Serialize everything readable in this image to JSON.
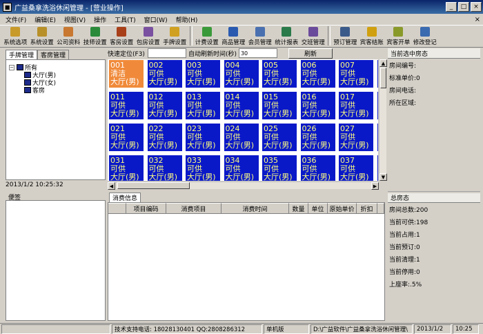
{
  "window": {
    "title": "广益桑拿洗浴休闲管理 - [营业操作]"
  },
  "menu": [
    "文件(F)",
    "编辑(E)",
    "视图(V)",
    "操作",
    "工具(T)",
    "窗口(W)",
    "帮助(H)"
  ],
  "toolbar": [
    {
      "label": "系统选项",
      "color": "#c89a2a",
      "icon": "system-options-icon"
    },
    {
      "label": "系统设置",
      "color": "#b8902a",
      "icon": "system-settings-icon"
    },
    {
      "label": "公司资料",
      "color": "#c87830",
      "icon": "company-info-icon"
    },
    {
      "label": "技师设置",
      "color": "#2a8a3a",
      "icon": "technician-icon"
    },
    {
      "label": "客房设置",
      "color": "#a8401a",
      "icon": "room-settings-icon"
    },
    {
      "label": "包房设置",
      "color": "#7a50a0",
      "icon": "private-room-icon"
    },
    {
      "label": "手牌设置",
      "color": "#d0a020",
      "icon": "hand-tag-icon"
    },
    {
      "label": "计费设置",
      "color": "#3a9a3a",
      "icon": "billing-icon"
    },
    {
      "label": "商品管理",
      "color": "#2a5ab0",
      "icon": "goods-icon"
    },
    {
      "label": "会员管理",
      "color": "#4a70b0",
      "icon": "member-icon"
    },
    {
      "label": "统计报表",
      "color": "#2a7a4a",
      "icon": "report-icon"
    },
    {
      "label": "交班管理",
      "color": "#6a4a9a",
      "icon": "shift-icon"
    },
    {
      "label": "预订管理",
      "color": "#3a5a8a",
      "icon": "booking-icon"
    },
    {
      "label": "宾客结账",
      "color": "#d0a010",
      "icon": "checkout-icon"
    },
    {
      "label": "宾客开单",
      "color": "#8a9a2a",
      "icon": "open-order-icon"
    },
    {
      "label": "修改登记",
      "color": "#3a6ab0",
      "icon": "edit-register-icon"
    }
  ],
  "left": {
    "tabs": [
      "手牌管理",
      "客房管理"
    ],
    "tree": {
      "root": "所有",
      "children": [
        "大厅(男)",
        "大厅(女)",
        "客房"
      ]
    },
    "datetime": "2013/1/2  10:25:32",
    "note_label": "便签"
  },
  "search": {
    "quick_locate": "快速定位(F3)",
    "refresh_interval_label": "自动刷新时间(秒)",
    "refresh_interval": "30",
    "refresh_button": "刷新"
  },
  "rooms": [
    {
      "no": "001",
      "status": "清洁",
      "area": "大厅(男)",
      "state": "clean"
    },
    {
      "no": "002",
      "status": "可供",
      "area": "大厅(男)"
    },
    {
      "no": "003",
      "status": "可供",
      "area": "大厅(男)"
    },
    {
      "no": "004",
      "status": "可供",
      "area": "大厅(男)"
    },
    {
      "no": "005",
      "status": "可供",
      "area": "大厅(男)"
    },
    {
      "no": "006",
      "status": "可供",
      "area": "大厅(男)"
    },
    {
      "no": "007",
      "status": "可供",
      "area": "大厅(男)"
    },
    {
      "no": "011",
      "status": "可供",
      "area": "大厅(男)"
    },
    {
      "no": "012",
      "status": "可供",
      "area": "大厅(男)"
    },
    {
      "no": "013",
      "status": "可供",
      "area": "大厅(男)"
    },
    {
      "no": "014",
      "status": "可供",
      "area": "大厅(男)"
    },
    {
      "no": "015",
      "status": "可供",
      "area": "大厅(男)"
    },
    {
      "no": "016",
      "status": "可供",
      "area": "大厅(男)"
    },
    {
      "no": "017",
      "status": "可供",
      "area": "大厅(男)"
    },
    {
      "no": "021",
      "status": "可供",
      "area": "大厅(男)"
    },
    {
      "no": "022",
      "status": "可供",
      "area": "大厅(男)"
    },
    {
      "no": "023",
      "status": "可供",
      "area": "大厅(男)"
    },
    {
      "no": "024",
      "status": "可供",
      "area": "大厅(男)"
    },
    {
      "no": "025",
      "status": "可供",
      "area": "大厅(男)"
    },
    {
      "no": "026",
      "status": "可供",
      "area": "大厅(男)"
    },
    {
      "no": "027",
      "status": "可供",
      "area": "大厅(男)"
    },
    {
      "no": "031",
      "status": "可供",
      "area": "大厅(男)"
    },
    {
      "no": "032",
      "status": "可供",
      "area": "大厅(男)"
    },
    {
      "no": "033",
      "status": "可供",
      "area": "大厅(男)"
    },
    {
      "no": "034",
      "status": "可供",
      "area": "大厅(男)"
    },
    {
      "no": "035",
      "status": "可供",
      "area": "大厅(男)"
    },
    {
      "no": "036",
      "status": "可供",
      "area": "大厅(男)"
    },
    {
      "no": "037",
      "status": "可供",
      "area": "大厅(男)"
    }
  ],
  "consumption": {
    "tab": "消费信息",
    "columns": [
      "项目编码",
      "消费项目",
      "消费时间",
      "数量",
      "单位",
      "原始单价",
      "折扣",
      "折..."
    ]
  },
  "current_room": {
    "title": "当前选中房态",
    "fields": [
      "房间编号:",
      "标准单价:0",
      "房间电话:",
      "所在区域:"
    ]
  },
  "summary": {
    "title": "总房态",
    "lines": [
      "房间总数:200",
      "当前可供:198",
      "当前占用:1",
      "当前预订:0",
      "当前清理:1",
      "当前停用:0",
      "上座率:.5%"
    ]
  },
  "status": {
    "support": "技术支持电话: 18028130401 QQ:2808286312",
    "mode": "单机版",
    "path": "D:\\广益软件\\广益桑拿洗浴休闲管理\\",
    "date": "2013/1/2",
    "time": "10:25"
  }
}
